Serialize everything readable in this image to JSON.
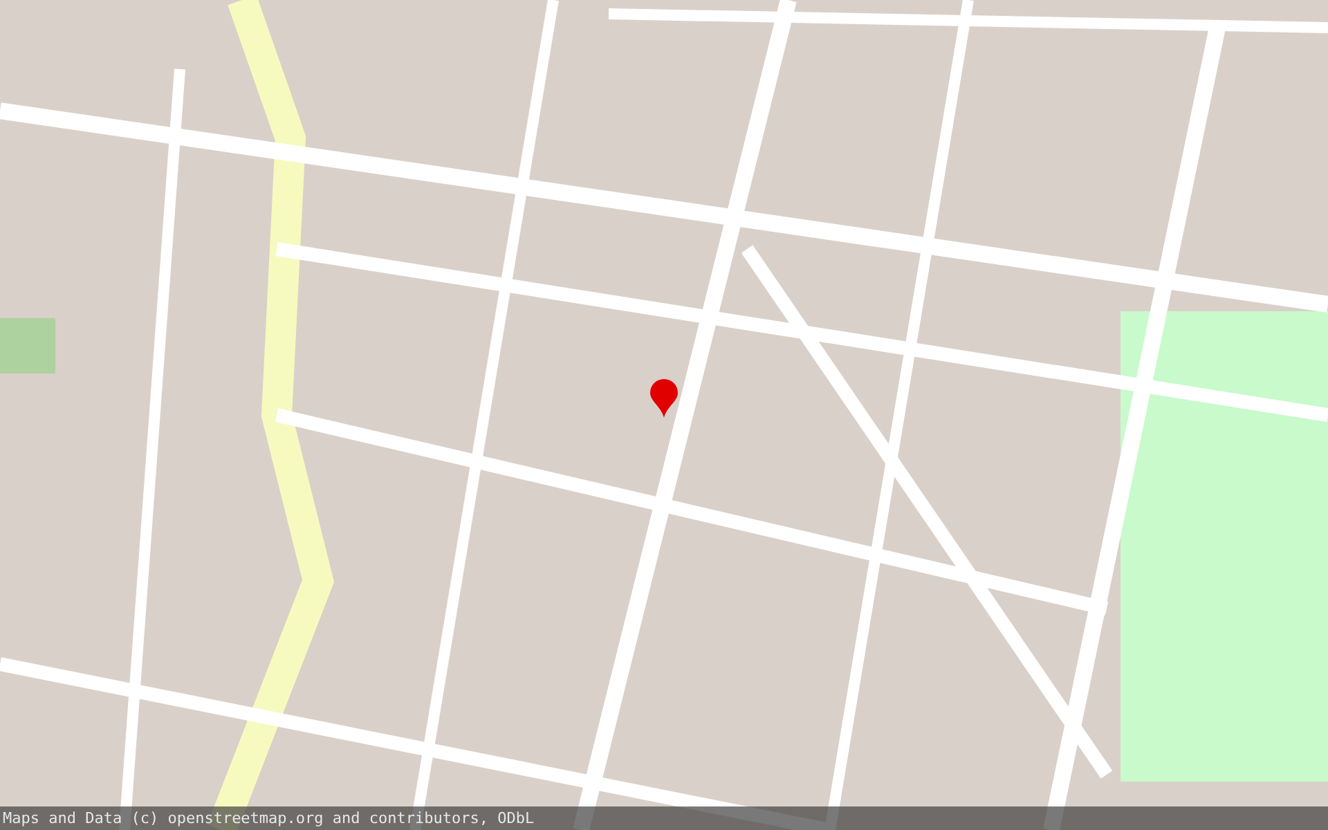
{
  "map": {
    "marker": {
      "visible": true
    },
    "attribution": "Maps and Data (c) openstreetmap.org and contributors, ODbL"
  }
}
